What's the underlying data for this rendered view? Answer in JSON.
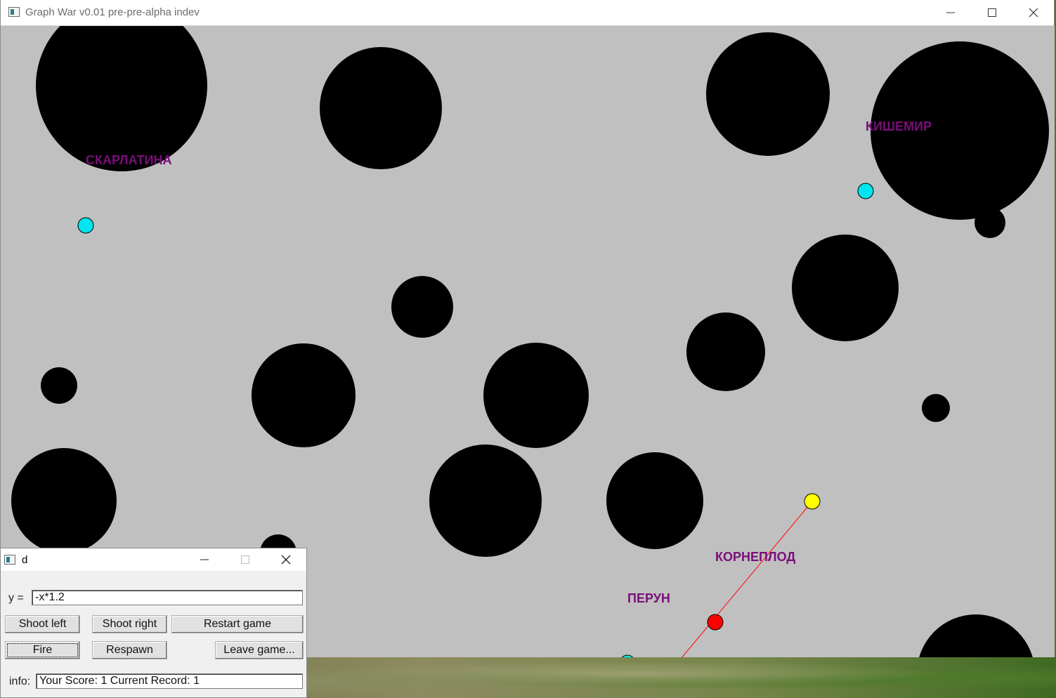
{
  "main_window": {
    "title": "Graph War v0.01 pre-pre-alpha indev",
    "controls": {
      "minimize": "—",
      "maximize": "☐",
      "close": "✕"
    }
  },
  "game": {
    "background_color": "#c0c0c0",
    "players": [
      {
        "name": "СКАРЛАТИНА",
        "color": "#00e5ee"
      },
      {
        "name": "КИШЕМИР",
        "color": "#00e5ee"
      },
      {
        "name": "КОРНЕПЛОД",
        "color": "#ff0000"
      },
      {
        "name": "ПЕРУН",
        "color": "#00e5ee"
      }
    ],
    "target_marker_color": "#ffff00",
    "shot_line_color": "#ff0000",
    "label_color": "#7a0d7a"
  },
  "control_window": {
    "title": "d",
    "controls": {
      "minimize": "—",
      "maximize": "☐",
      "close": "✕"
    },
    "function_label": "y =",
    "function_value": "-x*1.2",
    "buttons": {
      "shoot_left": "Shoot left",
      "shoot_right": "Shoot right",
      "restart": "Restart game",
      "fire": "Fire",
      "respawn": "Respawn",
      "leave": "Leave game..."
    },
    "info_label": "info:",
    "info_value": "Your Score: 1  Current Record: 1"
  }
}
